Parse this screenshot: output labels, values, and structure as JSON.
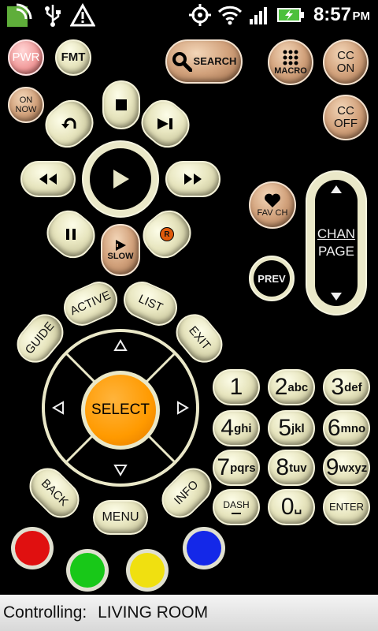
{
  "status_bar": {
    "time": "8:57",
    "ampm": "PM",
    "icons": [
      "app-icon",
      "usb-icon",
      "warning-icon",
      "gps-icon",
      "wifi-icon",
      "signal-icon",
      "battery-charging-icon"
    ]
  },
  "buttons": {
    "pwr": "PWR",
    "fmt": "FMT",
    "search": "SEARCH",
    "macro": "MACRO",
    "cc_on_1": "CC",
    "cc_on_2": "ON",
    "cc_off_1": "CC",
    "cc_off_2": "OFF",
    "on_now_1": "ON",
    "on_now_2": "NOW",
    "fav_ch": "FAV CH",
    "chan": "CHAN",
    "page": "PAGE",
    "prev": "PREV",
    "slow": "SLOW",
    "record": "R",
    "active": "ACTIVE",
    "list": "LIST",
    "guide": "GUIDE",
    "exit": "EXIT",
    "select": "SELECT",
    "back": "BACK",
    "menu": "MENU",
    "info": "INFO",
    "dash": "DASH",
    "enter": "ENTER"
  },
  "keypad": [
    {
      "digit": "1",
      "letters": ""
    },
    {
      "digit": "2",
      "letters": "abc"
    },
    {
      "digit": "3",
      "letters": "def"
    },
    {
      "digit": "4",
      "letters": "ghi"
    },
    {
      "digit": "5",
      "letters": "jkl"
    },
    {
      "digit": "6",
      "letters": "mno"
    },
    {
      "digit": "7",
      "letters": "pqrs"
    },
    {
      "digit": "8",
      "letters": "tuv"
    },
    {
      "digit": "9",
      "letters": "wxyz"
    },
    {
      "digit": "0",
      "letters": "␣"
    }
  ],
  "colors": {
    "red": "#e01010",
    "green": "#18c818",
    "yellow": "#f0e010",
    "blue": "#1428e8",
    "select": "#ff9a00"
  },
  "footer": {
    "label": "Controlling:",
    "device": "LIVING ROOM"
  }
}
